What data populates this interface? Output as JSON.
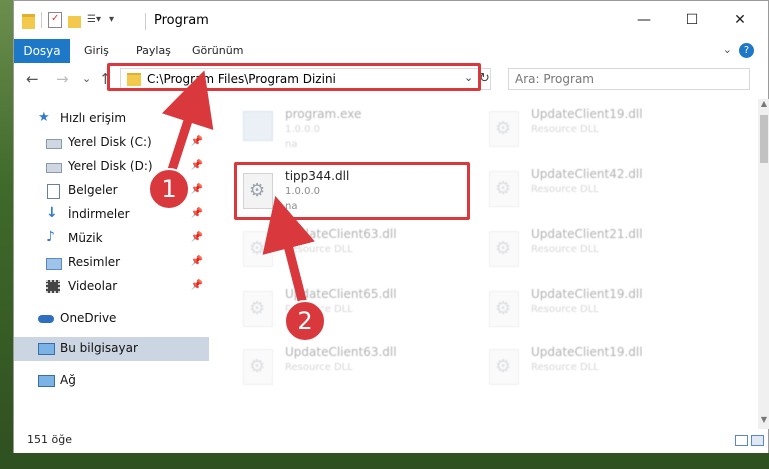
{
  "window": {
    "title": "Program",
    "controls": {
      "minimize": "—",
      "maximize": "☐",
      "close": "✕"
    }
  },
  "ribbon": {
    "file_tab": "Dosya",
    "tabs": [
      "Giriş",
      "Paylaş",
      "Görünüm"
    ],
    "help": "?",
    "expand": "⌄"
  },
  "nav": {
    "back": "←",
    "forward": "→",
    "recent": "⌄",
    "up": "↑",
    "address": "C:\\Program Files\\Program Dizini",
    "address_dropdown": "⌄",
    "refresh": "↻",
    "search_placeholder": "Ara: Program"
  },
  "sidebar": {
    "items": [
      {
        "label": "Hızlı erişim",
        "icon": "star-icon",
        "pinned": false
      },
      {
        "label": "Yerel Disk (C:)",
        "icon": "drive-icon",
        "pinned": true
      },
      {
        "label": "Yerel Disk (D:)",
        "icon": "drive-icon",
        "pinned": true
      },
      {
        "label": "Belgeler",
        "icon": "documents-icon",
        "pinned": true
      },
      {
        "label": "İndirmeler",
        "icon": "download-icon",
        "pinned": true
      },
      {
        "label": "Müzik",
        "icon": "music-icon",
        "pinned": true
      },
      {
        "label": "Resimler",
        "icon": "pictures-icon",
        "pinned": true
      },
      {
        "label": "Videolar",
        "icon": "videos-icon",
        "pinned": true
      },
      {
        "label": "OneDrive",
        "icon": "cloud-icon",
        "pinned": false
      },
      {
        "label": "Bu bilgisayar",
        "icon": "computer-icon",
        "pinned": false
      },
      {
        "label": "Ağ",
        "icon": "network-icon",
        "pinned": false
      }
    ]
  },
  "files": {
    "left": [
      {
        "name": "program.exe",
        "sub": "1.0.0.0",
        "sub2": "na"
      },
      {
        "name": "tipp344.dll",
        "sub": "1.0.0.0",
        "sub2": "na"
      },
      {
        "name": "UpdateClient63.dll",
        "sub": "Resource DLL"
      },
      {
        "name": "UpdateClient65.dll",
        "sub": "Resource DLL"
      },
      {
        "name": "UpdateClient63.dll",
        "sub": "Resource DLL"
      }
    ],
    "right": [
      {
        "name": "UpdateClient19.dll",
        "sub": "Resource DLL"
      },
      {
        "name": "UpdateClient42.dll",
        "sub": "Resource DLL"
      },
      {
        "name": "UpdateClient21.dll",
        "sub": "Resource DLL"
      },
      {
        "name": "UpdateClient19.dll",
        "sub": "Resource DLL"
      },
      {
        "name": "UpdateClient19.dll",
        "sub": "Resource DLL"
      }
    ]
  },
  "status": {
    "count": "151 öğe"
  },
  "annotations": {
    "step1": "1",
    "step2": "2",
    "color": "#d9383c"
  }
}
